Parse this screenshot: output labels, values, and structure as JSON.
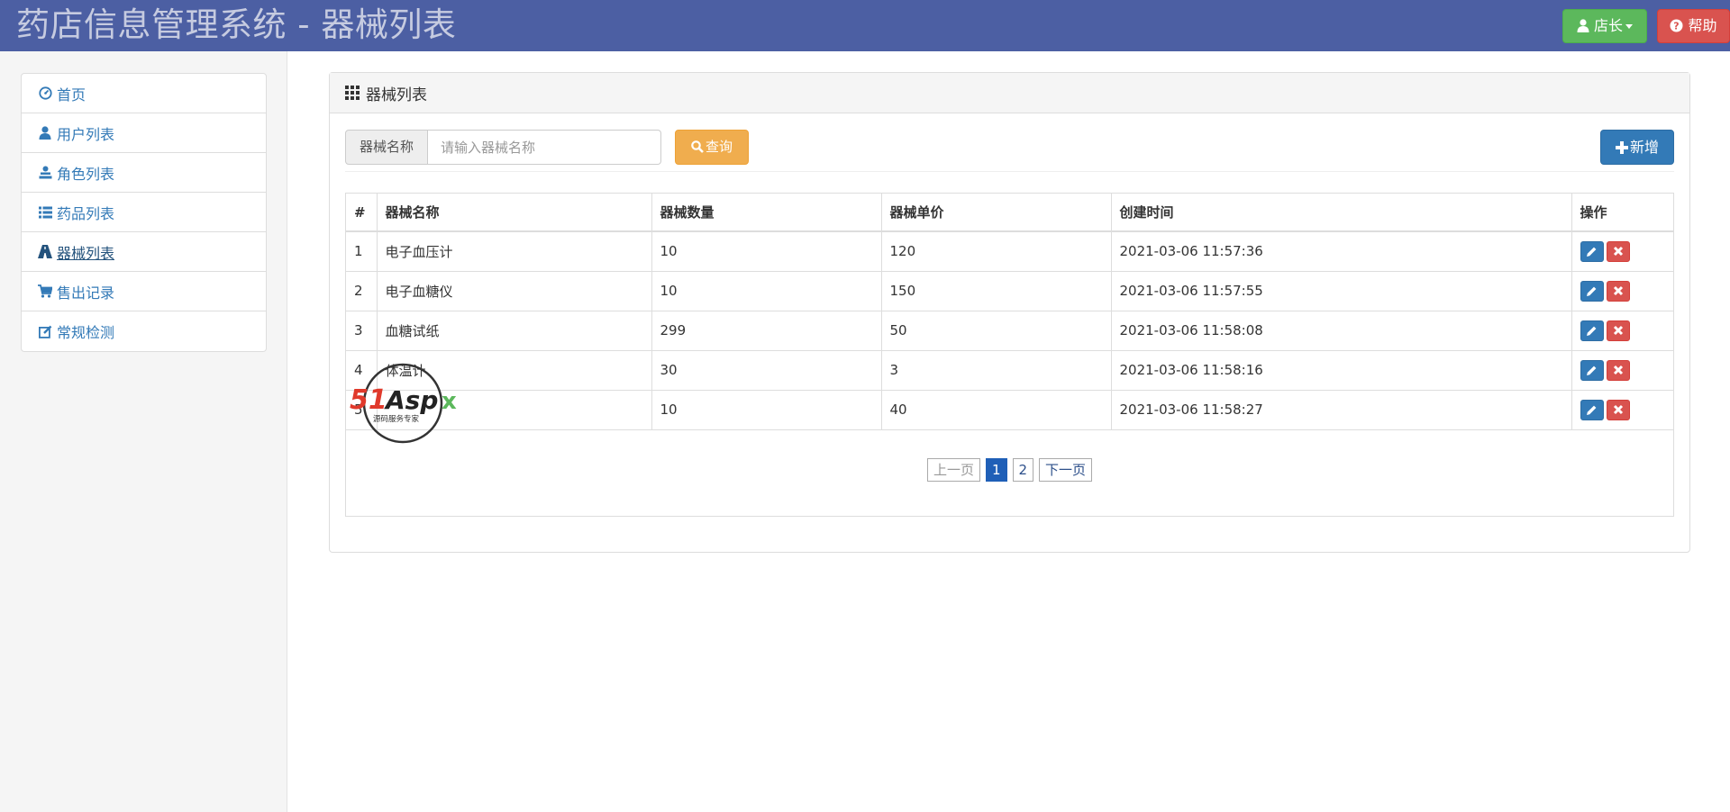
{
  "header": {
    "title": "药店信息管理系统 - 器械列表",
    "user_label": "店长",
    "help_label": "帮助"
  },
  "sidebar": {
    "items": [
      {
        "label": "首页",
        "icon": "dashboard-icon"
      },
      {
        "label": "用户列表",
        "icon": "user-icon"
      },
      {
        "label": "角色列表",
        "icon": "role-icon"
      },
      {
        "label": "药品列表",
        "icon": "list-icon"
      },
      {
        "label": "器械列表",
        "icon": "road-icon",
        "active": true
      },
      {
        "label": "售出记录",
        "icon": "cart-icon"
      },
      {
        "label": "常规检测",
        "icon": "edit-icon"
      }
    ]
  },
  "panel": {
    "title": "器械列表",
    "search_label": "器械名称",
    "search_placeholder": "请输入器械名称",
    "search_button": "查询",
    "add_button": "新增"
  },
  "table": {
    "headers": [
      "#",
      "器械名称",
      "器械数量",
      "器械单价",
      "创建时间",
      "操作"
    ],
    "rows": [
      {
        "id": "1",
        "name": "电子血压计",
        "qty": "10",
        "price": "120",
        "created": "2021-03-06 11:57:36"
      },
      {
        "id": "2",
        "name": "电子血糖仪",
        "qty": "10",
        "price": "150",
        "created": "2021-03-06 11:57:55"
      },
      {
        "id": "3",
        "name": "血糖试纸",
        "qty": "299",
        "price": "50",
        "created": "2021-03-06 11:58:08"
      },
      {
        "id": "4",
        "name": "体温计",
        "qty": "30",
        "price": "3",
        "created": "2021-03-06 11:58:16"
      },
      {
        "id": "5",
        "name": "",
        "qty": "10",
        "price": "40",
        "created": "2021-03-06 11:58:27"
      }
    ]
  },
  "pagination": {
    "prev": "上一页",
    "pages": [
      "1",
      "2"
    ],
    "current": "1",
    "next": "下一页"
  },
  "watermark": {
    "logo_text": "51Aspx",
    "tagline": "源码服务专家"
  },
  "colors": {
    "navbar": "#4c5fa3",
    "primary": "#337ab7",
    "success": "#5cb85c",
    "danger": "#d9534f",
    "warning": "#f0ad4e"
  }
}
